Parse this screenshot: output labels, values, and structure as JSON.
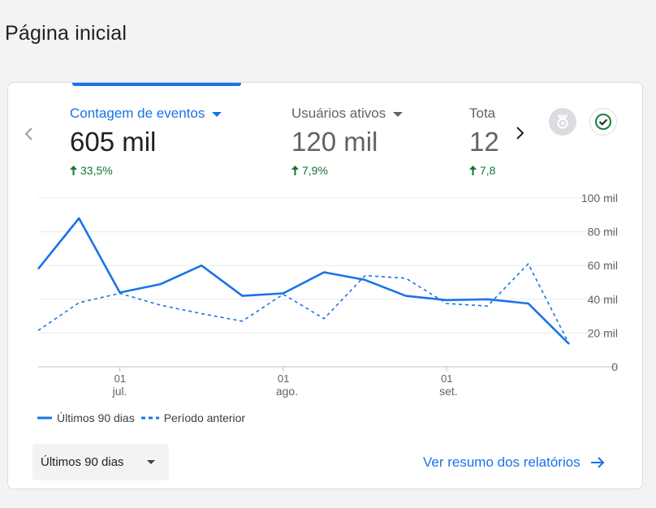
{
  "page": {
    "title": "Página inicial"
  },
  "metrics": [
    {
      "label": "Contagem de eventos",
      "value": "605 mil",
      "change": "33,5%"
    },
    {
      "label": "Usuários ativos",
      "value": "120 mil",
      "change": "7,9%"
    },
    {
      "label": "Tota",
      "value": "12(",
      "change": "7,8"
    }
  ],
  "icons": {
    "prev": "chevron-left-icon",
    "next": "chevron-right-icon",
    "insights": "insights-icon",
    "status": "check-circle-icon"
  },
  "colors": {
    "accent": "#1a73e8",
    "positive": "#137333",
    "status_ok": "#188038"
  },
  "chart_data": {
    "type": "line",
    "title": "",
    "xlabel": "",
    "ylabel": "",
    "ylim": [
      0,
      100000
    ],
    "yticks": [
      0,
      20000,
      40000,
      60000,
      80000,
      100000
    ],
    "ytick_labels": [
      "0",
      "20 mil",
      "40 mil",
      "60 mil",
      "80 mil",
      "100 mil"
    ],
    "xticks": [
      {
        "index": 2,
        "day": "01",
        "month": "jul."
      },
      {
        "index": 6,
        "day": "01",
        "month": "ago."
      },
      {
        "index": 10,
        "day": "01",
        "month": "set."
      }
    ],
    "grid": true,
    "legend_position": "bottom-left",
    "series": [
      {
        "name": "Últimos 90 dias",
        "style": "solid",
        "values": [
          58000,
          88000,
          44000,
          49000,
          60000,
          42000,
          43500,
          56000,
          51500,
          42000,
          39500,
          40000,
          37500,
          13500
        ]
      },
      {
        "name": "Período anterior",
        "style": "dashed",
        "values": [
          21500,
          38000,
          43500,
          36500,
          31500,
          27000,
          43000,
          28500,
          54000,
          52500,
          37500,
          36000,
          61000,
          13500
        ]
      }
    ]
  },
  "footer": {
    "range_label": "Últimos 90 dias",
    "reports_link": "Ver resumo dos relatórios"
  }
}
